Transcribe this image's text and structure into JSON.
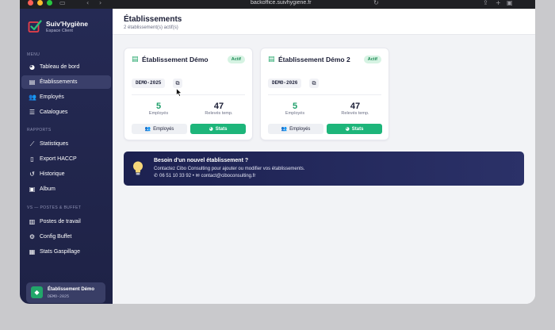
{
  "browser": {
    "url": "backoffice.suivhygiene.fr"
  },
  "brand": {
    "name": "Suiv'Hygiène",
    "subtitle": "Espace Client"
  },
  "sidebar": {
    "sections": [
      {
        "label": "MENU",
        "items": [
          {
            "label": "Tableau de bord",
            "icon": "pie-chart-icon",
            "active": false
          },
          {
            "label": "Établissements",
            "icon": "store-icon",
            "active": true
          },
          {
            "label": "Employés",
            "icon": "users-icon",
            "active": false
          },
          {
            "label": "Catalogues",
            "icon": "list-icon",
            "active": false
          }
        ]
      },
      {
        "label": "RAPPORTS",
        "items": [
          {
            "label": "Statistiques",
            "icon": "line-chart-icon",
            "active": false
          },
          {
            "label": "Export HACCP",
            "icon": "file-icon",
            "active": false
          },
          {
            "label": "Historique",
            "icon": "history-icon",
            "active": false
          },
          {
            "label": "Album",
            "icon": "image-icon",
            "active": false
          }
        ]
      },
      {
        "label": "VS — POSTES & BUFFET",
        "items": [
          {
            "label": "Postes de travail",
            "icon": "workstation-icon",
            "active": false
          },
          {
            "label": "Config Buffet",
            "icon": "gear-icon",
            "active": false
          },
          {
            "label": "Stats Gaspillage",
            "icon": "stats-icon",
            "active": false
          }
        ]
      }
    ],
    "current_establishment": {
      "name": "Établissement Démo",
      "code": "DEMO-2025"
    }
  },
  "page": {
    "title": "Établissements",
    "subtitle": "2 établissement(s) actif(s)"
  },
  "establishments": [
    {
      "name": "Établissement Démo",
      "status": "Actif",
      "code": "DEMO-2025",
      "employees_count": "5",
      "employees_label": "Employés",
      "readings_count": "47",
      "readings_label": "Relevés temp.",
      "employees_button": "Employés",
      "stats_button": "Stats"
    },
    {
      "name": "Établissement Démo 2",
      "status": "Actif",
      "code": "DEMO-2026",
      "employees_count": "5",
      "employees_label": "Employés",
      "readings_count": "47",
      "readings_label": "Relevés temp.",
      "employees_button": "Employés",
      "stats_button": "Stats"
    }
  ],
  "banner": {
    "title": "Besoin d'un nouvel établissement ?",
    "text": "Contactez Cibo Consulting pour ajouter ou modifier vos établissements.",
    "phone": "06 51 10 33 92",
    "separator": "•",
    "email": "contact@ciboconsulting.fr"
  },
  "colors": {
    "sidebar": "#252a54",
    "accent_green": "#1db57a",
    "stat_green": "#1e9f6a",
    "banner": "#1c2150"
  }
}
